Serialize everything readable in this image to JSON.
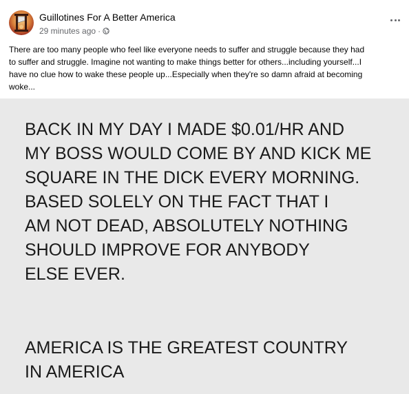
{
  "post": {
    "page_name": "Guillotines For A Better America",
    "timestamp": "29 minutes ago",
    "separator": "·",
    "audience_icon": "globe-icon",
    "more_icon": "more-options-icon",
    "caption_lines": [
      "There are too many people who feel like everyone needs to suffer and struggle because they had",
      "to suffer and struggle. Imagine not wanting to make things better for others...including yourself...I",
      "have no clue how to wake these people up...Especially when they're so damn afraid at becoming",
      "woke..."
    ]
  },
  "image": {
    "background_color": "#e9e9e9",
    "paragraph1": [
      "BACK IN MY DAY I MADE $0.01/HR AND",
      "MY BOSS WOULD COME BY AND KICK ME",
      "SQUARE IN THE DICK EVERY MORNING.",
      "BASED SOLELY ON THE FACT THAT I",
      "AM NOT DEAD, ABSOLUTELY NOTHING",
      "SHOULD IMPROVE FOR ANYBODY",
      "ELSE EVER."
    ],
    "paragraph2": [
      "AMERICA IS THE GREATEST COUNTRY",
      "IN AMERICA"
    ]
  }
}
